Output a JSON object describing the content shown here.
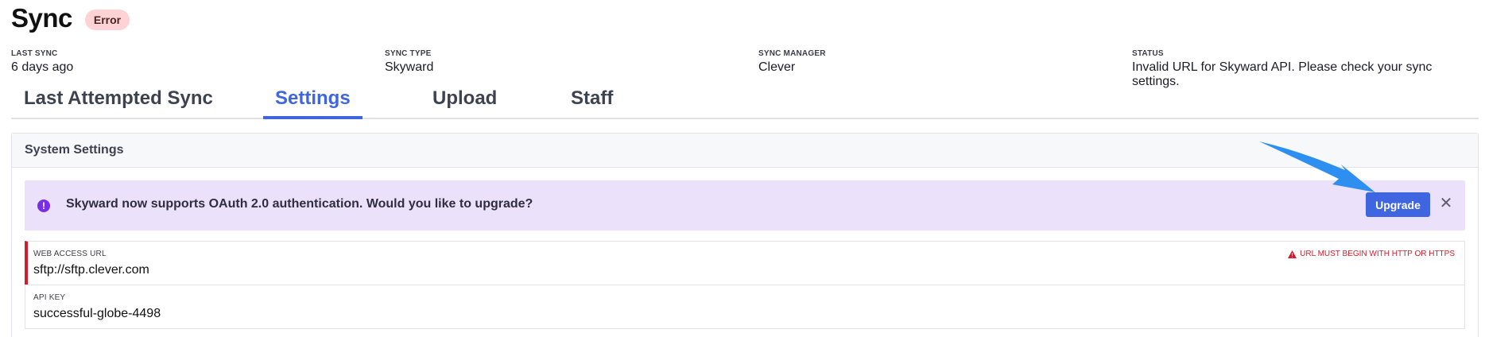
{
  "header": {
    "title": "Sync",
    "status_badge": "Error"
  },
  "meta": {
    "last_sync": {
      "label": "LAST SYNC",
      "value": "6 days ago"
    },
    "sync_type": {
      "label": "SYNC TYPE",
      "value": "Skyward"
    },
    "sync_manager": {
      "label": "SYNC MANAGER",
      "value": "Clever"
    },
    "status": {
      "label": "STATUS",
      "value": "Invalid URL for Skyward API. Please check your sync settings."
    }
  },
  "tabs": [
    {
      "label": "Last Attempted Sync",
      "active": false
    },
    {
      "label": "Settings",
      "active": true
    },
    {
      "label": "Upload",
      "active": false
    },
    {
      "label": "Staff",
      "active": false
    }
  ],
  "panel": {
    "title": "System Settings",
    "banner": {
      "icon": "exclamation-circle-icon",
      "text": "Skyward now supports OAuth 2.0 authentication. Would you like to upgrade?",
      "button_label": "Upgrade",
      "close_icon": "close-icon"
    },
    "fields": [
      {
        "label": "WEB ACCESS URL",
        "value": "sftp://sftp.clever.com",
        "error": "URL MUST BEGIN WITH HTTP OR HTTPS",
        "error_icon": "warning-icon"
      },
      {
        "label": "API KEY",
        "value": "successful-globe-4498"
      }
    ]
  },
  "colors": {
    "accent": "#3f66e0",
    "error": "#d41c2a",
    "banner_bg": "#ebe1fb",
    "badge_bg": "#ffd3d6",
    "annotation_arrow": "#2f8ff0"
  }
}
